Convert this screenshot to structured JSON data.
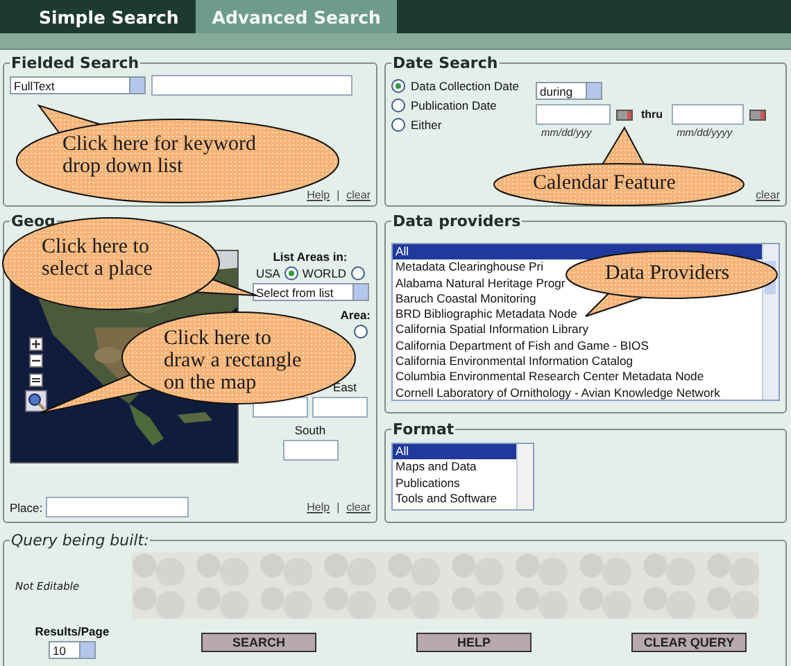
{
  "tabs": [
    {
      "label": "Simple Search",
      "selected": false
    },
    {
      "label": "Advanced Search",
      "selected": true
    }
  ],
  "fielded_search": {
    "title": "Fielded Search",
    "field": "FullText",
    "links": [
      "Help",
      "clear"
    ],
    "separator": "|"
  },
  "date_search": {
    "title": "Date Search",
    "options": [
      {
        "label": "Data Collection Date",
        "selected": true
      },
      {
        "label": "Publication Date",
        "selected": false
      },
      {
        "label": "Either",
        "selected": false
      }
    ],
    "operator": "during",
    "thru": "thru",
    "formats": [
      "mm/dd/yyy",
      "mm/dd/yyyy"
    ],
    "links": [
      "clear"
    ]
  },
  "geographic": {
    "title": "Geog",
    "list_label": "List Areas in:",
    "scopes": [
      {
        "label": "USA",
        "selected": true
      },
      {
        "label": "WORLD",
        "selected": false
      }
    ],
    "area_select": "Select from list",
    "area_label": "Area:",
    "area_option_selected": false,
    "east": "East",
    "south": "South",
    "place_label": "Place:",
    "links": [
      "Help",
      "clear"
    ],
    "separator": "|"
  },
  "data_providers": {
    "title": "Data providers",
    "items": [
      {
        "label": "All",
        "selected": true
      },
      {
        "label": "Metadata Clearinghouse Pri",
        "selected": false
      },
      {
        "label": "Alabama Natural Heritage Progr",
        "selected": false
      },
      {
        "label": "Baruch Coastal Monitoring",
        "selected": false
      },
      {
        "label": "BRD Bibliographic Metadata Node",
        "selected": false
      },
      {
        "label": "California Spatial Information Library",
        "selected": false
      },
      {
        "label": "California Department of Fish and Game - BIOS",
        "selected": false
      },
      {
        "label": "California Environmental Information Catalog",
        "selected": false
      },
      {
        "label": "Columbia Environmental Research Center Metadata Node",
        "selected": false
      },
      {
        "label": "Cornell Laboratory of Ornithology - Avian Knowledge Network",
        "selected": false
      }
    ]
  },
  "format": {
    "title": "Format",
    "items": [
      {
        "label": "All",
        "selected": true
      },
      {
        "label": "Maps and Data",
        "selected": false
      },
      {
        "label": "Publications",
        "selected": false
      },
      {
        "label": "Tools and Software",
        "selected": false
      }
    ]
  },
  "query": {
    "title": "Query being built:",
    "note": "Not Editable",
    "results_label": "Results/Page",
    "results_value": "10",
    "buttons": [
      "SEARCH",
      "HELP",
      "CLEAR QUERY"
    ]
  },
  "callouts": [
    {
      "lines": [
        "Click here for keyword",
        "drop down list"
      ]
    },
    {
      "lines": [
        "Calendar Feature"
      ]
    },
    {
      "lines": [
        "Click here to",
        "select a place"
      ]
    },
    {
      "lines": [
        "Click here to",
        "draw a rectangle",
        "on the map"
      ]
    },
    {
      "lines": [
        "Data Providers"
      ]
    }
  ]
}
